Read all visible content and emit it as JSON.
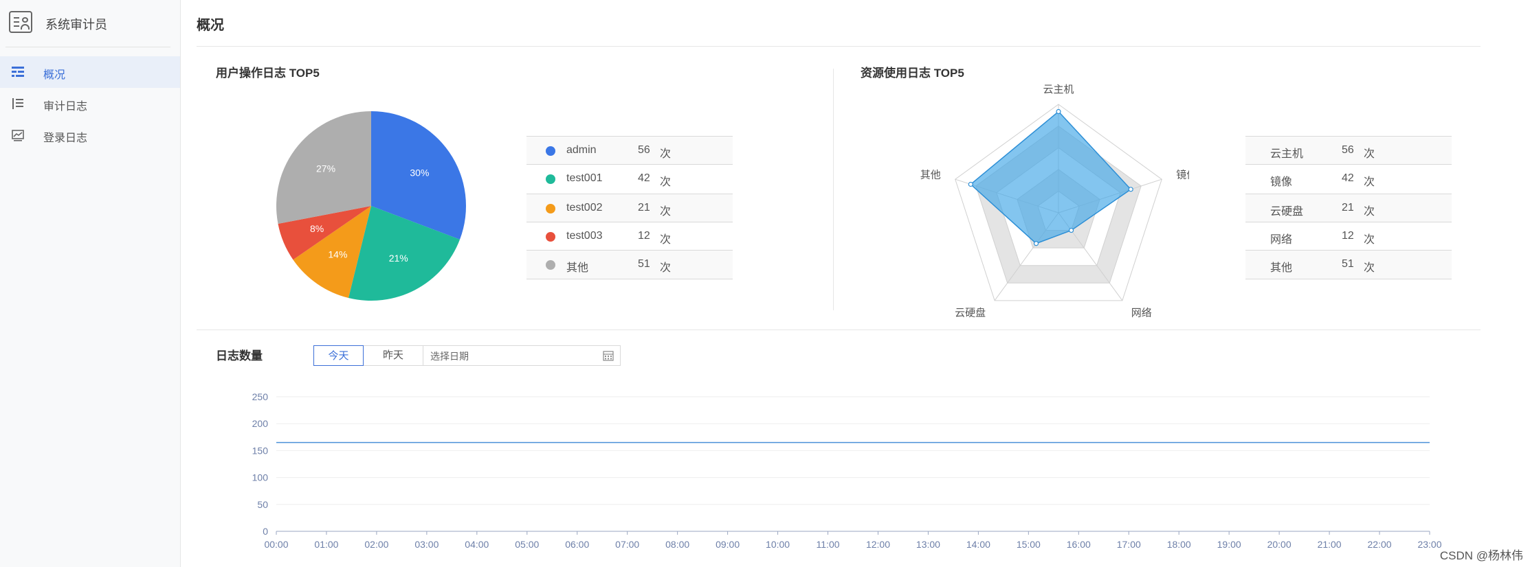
{
  "sidebar": {
    "title": "系统审计员",
    "items": [
      {
        "label": "概况",
        "icon": "dashboard-icon",
        "active": true
      },
      {
        "label": "审计日志",
        "icon": "list-icon",
        "active": false
      },
      {
        "label": "登录日志",
        "icon": "chart-icon",
        "active": false
      }
    ]
  },
  "page": {
    "title": "概况"
  },
  "user_log": {
    "title": "用户操作日志 TOP5",
    "unit": "次",
    "colors": [
      "#3b77e6",
      "#1fba9a",
      "#f49b1a",
      "#e8503c",
      "#aeaeae"
    ],
    "legend": [
      {
        "name": "admin",
        "value": "56"
      },
      {
        "name": "test001",
        "value": "42"
      },
      {
        "name": "test002",
        "value": "21"
      },
      {
        "name": "test003",
        "value": "12"
      },
      {
        "name": "其他",
        "value": "51"
      }
    ]
  },
  "resource_log": {
    "title": "资源使用日志 TOP5",
    "unit": "次",
    "legend": [
      {
        "name": "云主机",
        "value": "56"
      },
      {
        "name": "镜像",
        "value": "42"
      },
      {
        "name": "云硬盘",
        "value": "21"
      },
      {
        "name": "网络",
        "value": "12"
      },
      {
        "name": "其他",
        "value": "51"
      }
    ]
  },
  "log_count": {
    "title": "日志数量",
    "today_label": "今天",
    "yesterday_label": "昨天",
    "date_placeholder": "选择日期"
  },
  "chart_data": [
    {
      "type": "pie",
      "title": "用户操作日志 TOP5",
      "categories": [
        "admin",
        "test001",
        "test002",
        "test003",
        "其他"
      ],
      "values": [
        56,
        42,
        21,
        12,
        51
      ],
      "labels": [
        "30%",
        "21%",
        "14%",
        "8%",
        "27%"
      ]
    },
    {
      "type": "radar",
      "title": "资源使用日志 TOP5",
      "categories": [
        "云主机",
        "镜像",
        "网络",
        "云硬盘",
        "其他"
      ],
      "values": [
        56,
        42,
        12,
        21,
        51
      ],
      "max": 60
    },
    {
      "type": "line",
      "title": "日志数量",
      "x": [
        "00:00",
        "01:00",
        "02:00",
        "03:00",
        "04:00",
        "05:00",
        "06:00",
        "07:00",
        "08:00",
        "09:00",
        "10:00",
        "11:00",
        "12:00",
        "13:00",
        "14:00",
        "15:00",
        "16:00",
        "17:00",
        "18:00",
        "19:00",
        "20:00",
        "21:00",
        "22:00",
        "23:00"
      ],
      "series": [
        {
          "values": [
            165,
            165,
            165,
            165,
            165,
            165,
            165,
            165,
            165,
            165,
            165,
            165,
            165,
            165,
            165,
            165,
            165,
            165,
            165,
            165,
            165,
            165,
            165,
            165
          ]
        }
      ],
      "ylim": [
        0,
        250
      ],
      "yticks": [
        0,
        50,
        100,
        150,
        200,
        250
      ],
      "grid": true
    }
  ],
  "watermark": "CSDN @杨林伟"
}
